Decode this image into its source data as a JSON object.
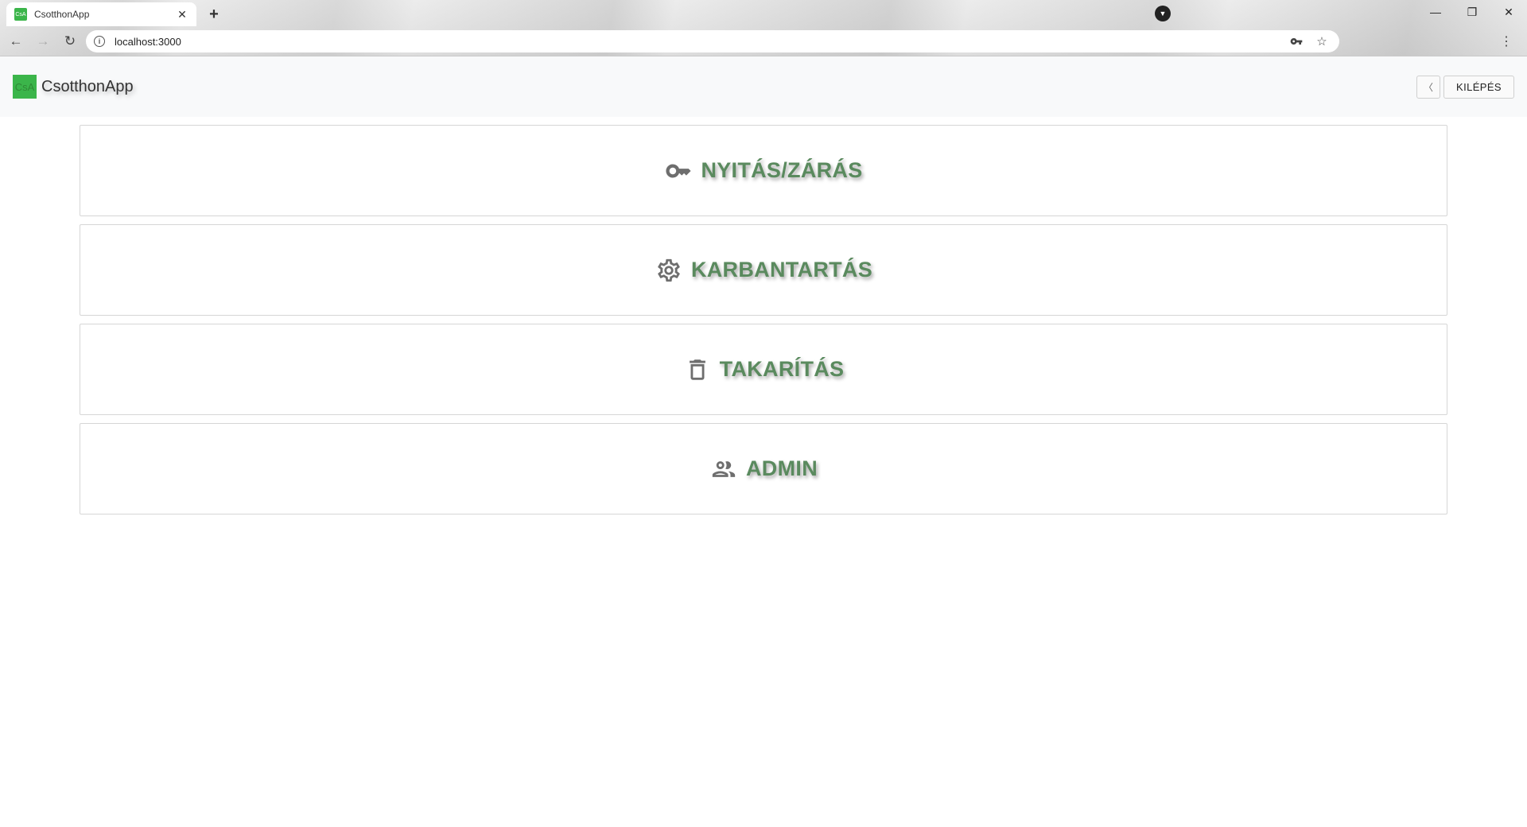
{
  "browser": {
    "tab_title": "CsotthonApp",
    "favicon_text": "CsA",
    "url": "localhost:3000",
    "close_tab_glyph": "✕",
    "new_tab_glyph": "+",
    "minimize_glyph": "—",
    "restore_glyph": "❐",
    "close_window_glyph": "✕"
  },
  "header": {
    "logo_text": "CsA",
    "brand": "CsotthonApp",
    "back_glyph": "〈",
    "logout_label": "KILÉPÉS"
  },
  "menu": {
    "items": [
      {
        "label": "NYITÁS/ZÁRÁS",
        "icon": "key-icon"
      },
      {
        "label": "KARBANTARTÁS",
        "icon": "gear-icon"
      },
      {
        "label": "TAKARÍTÁS",
        "icon": "trash-icon"
      },
      {
        "label": "ADMIN",
        "icon": "users-icon"
      }
    ]
  },
  "colors": {
    "brand_green": "#3bb54a",
    "label_green": "#5a8a5e",
    "icon_gray": "#6e6e6e",
    "header_bg": "#f8f9fa"
  }
}
